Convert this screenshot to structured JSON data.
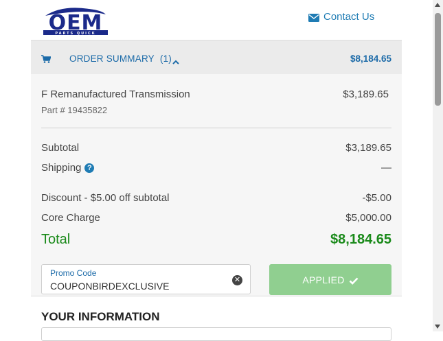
{
  "brand": {
    "logo_text": "OEM",
    "logo_subtext": "PARTS QUICK",
    "color_primary": "#1b6aa8",
    "color_success": "#1a8a1a",
    "color_button_disabled": "#90cf90"
  },
  "header": {
    "contact_label": "Contact Us",
    "contact_icon": "envelope-icon"
  },
  "order_summary": {
    "cart_icon": "shopping-cart-icon",
    "label": "ORDER SUMMARY",
    "count": "(1)",
    "toggle_icon": "chevron-up-icon",
    "total": "$8,184.65"
  },
  "items": [
    {
      "name": "F Remanufactured Transmission",
      "part_number": "Part # 19435822",
      "price": "$3,189.65"
    }
  ],
  "totals": {
    "subtotal_label": "Subtotal",
    "subtotal_value": "$3,189.65",
    "shipping_label": "Shipping",
    "shipping_help_icon": "question-circle-icon",
    "shipping_value": "—",
    "discount_label": "Discount - $5.00 off subtotal",
    "discount_value": "-$5.00",
    "core_label": "Core Charge",
    "core_value": "$5,000.00",
    "total_label": "Total",
    "total_value": "$8,184.65"
  },
  "promo": {
    "label": "Promo Code",
    "value": "COUPONBIRDEXCLUSIVE",
    "clear_icon": "times-circle-icon",
    "button_label": "APPLIED",
    "button_icon": "checkmark-icon"
  },
  "your_information": {
    "heading": "YOUR INFORMATION"
  }
}
